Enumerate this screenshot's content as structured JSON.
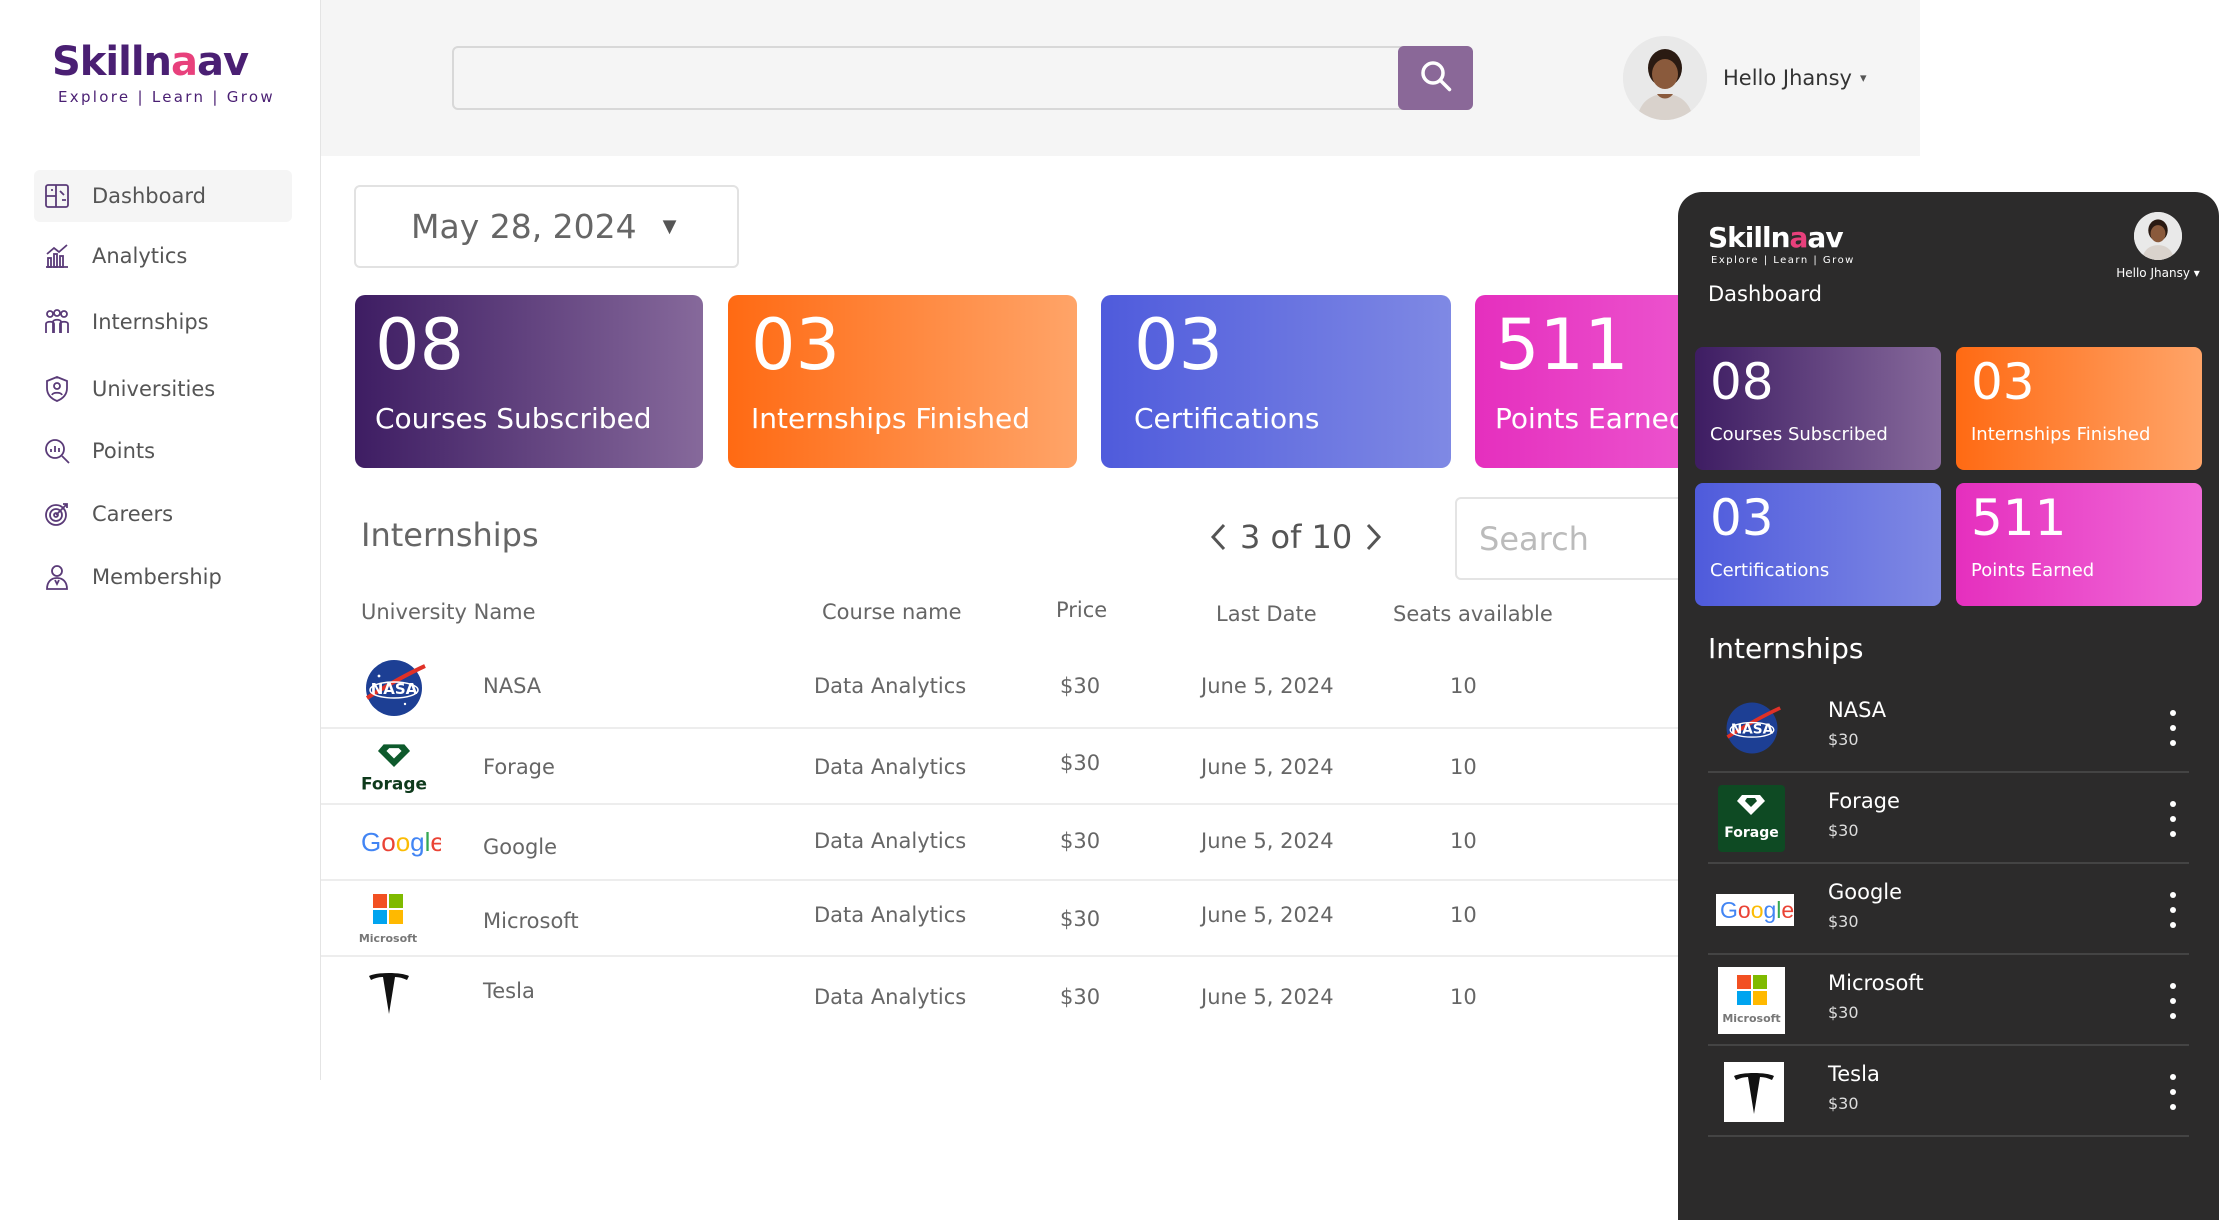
{
  "brand": {
    "name_a": "Skilln",
    "name_o": "a",
    "name_b": "av",
    "tagline": "Explore | Learn | Grow"
  },
  "sidebar": {
    "items": [
      {
        "label": "Dashboard",
        "icon": "dashboard-icon",
        "active": true
      },
      {
        "label": "Analytics",
        "icon": "analytics-icon"
      },
      {
        "label": "Internships",
        "icon": "internships-icon"
      },
      {
        "label": "Universities",
        "icon": "universities-icon"
      },
      {
        "label": "Points",
        "icon": "points-icon"
      },
      {
        "label": "Careers",
        "icon": "careers-icon"
      },
      {
        "label": "Membership",
        "icon": "membership-icon"
      }
    ]
  },
  "header": {
    "search_placeholder": "",
    "user_greeting": "Hello Jhansy",
    "caret": "▾"
  },
  "main": {
    "date": "May 28, 2024",
    "date_caret": "▼",
    "stats": [
      {
        "value": "08",
        "label": "Courses Subscribed",
        "colors": [
          "#3e1d63",
          "#86699b"
        ]
      },
      {
        "value": "03",
        "label": "Internships Finished",
        "colors": [
          "#ff6a13",
          "#ffa468"
        ]
      },
      {
        "value": "03",
        "label": "Certifications",
        "colors": [
          "#4f5bdc",
          "#7f89e4"
        ]
      },
      {
        "value": "511",
        "label": "Points Earned",
        "colors": [
          "#e52fbe",
          "#f06ad8"
        ]
      }
    ],
    "section_title": "Internships",
    "pager": {
      "text": "3 of 10"
    },
    "table_search_placeholder": "Search",
    "columns": [
      "University Name",
      "Course name",
      "Price",
      "Last Date",
      "Seats available"
    ],
    "rows": [
      {
        "university": "NASA",
        "course": "Data Analytics",
        "price": "$30",
        "last_date": "June 5, 2024",
        "seats": "10"
      },
      {
        "university": "Forage",
        "course": "Data Analytics",
        "price": "$30",
        "last_date": "June 5, 2024",
        "seats": "10"
      },
      {
        "university": "Google",
        "course": "Data Analytics",
        "price": "$30",
        "last_date": "June 5, 2024",
        "seats": "10"
      },
      {
        "university": "Microsoft",
        "course": "Data Analytics",
        "price": "$30",
        "last_date": "June 5, 2024",
        "seats": "10"
      },
      {
        "university": "Tesla",
        "course": "Data Analytics",
        "price": "$30",
        "last_date": "June 5, 2024",
        "seats": "10"
      }
    ]
  },
  "logos": {
    "nasa": "NASA",
    "forage": "Forage",
    "google": "Google",
    "microsoft": "Microsoft"
  },
  "mobile": {
    "user_greeting": "Hello Jhansy ▾",
    "title": "Dashboard",
    "section_title": "Internships",
    "items": [
      {
        "name": "NASA",
        "price": "$30"
      },
      {
        "name": "Forage",
        "price": "$30"
      },
      {
        "name": "Google",
        "price": "$30"
      },
      {
        "name": "Microsoft",
        "price": "$30"
      },
      {
        "name": "Tesla",
        "price": "$30"
      }
    ]
  }
}
